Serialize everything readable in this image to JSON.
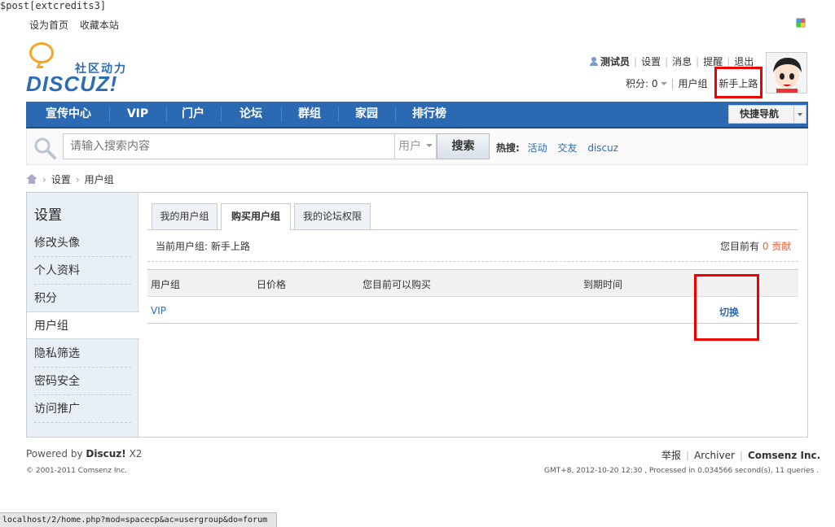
{
  "debug_text": "$post[extcredits3]",
  "top_links": [
    "设为首页",
    "收藏本站"
  ],
  "logo": {
    "text": "DISCUZ!",
    "subtitle": "社区动力"
  },
  "user": {
    "name": "测试员",
    "links": [
      "设置",
      "消息",
      "提醒",
      "退出"
    ],
    "credits_label": "积分: 0",
    "group_label": "用户组",
    "group_value": "新手上路"
  },
  "nav": {
    "items": [
      "宣传中心",
      "VIP",
      "门户",
      "论坛",
      "群组",
      "家园",
      "排行榜"
    ],
    "quick_nav": "快捷导航"
  },
  "search": {
    "placeholder": "请输入搜索内容",
    "type": "用户",
    "button": "搜索",
    "hot_label": "热搜:",
    "hot_links": [
      "活动",
      "交友",
      "discuz"
    ]
  },
  "breadcrumb": [
    "设置",
    "用户组"
  ],
  "sidebar": {
    "title": "设置",
    "items": [
      "修改头像",
      "个人资料",
      "积分",
      "用户组",
      "隐私筛选",
      "密码安全",
      "访问推广"
    ],
    "active": "用户组"
  },
  "tabs": [
    "我的用户组",
    "购买用户组",
    "我的论坛权限"
  ],
  "active_tab": "购买用户组",
  "current_group": "当前用户组: 新手上路",
  "balance": {
    "label": "您目前有",
    "value": "0 贡献"
  },
  "table": {
    "headers": [
      "用户组",
      "日价格",
      "您目前可以购买",
      "到期时间"
    ],
    "rows": [
      {
        "group": "VIP",
        "action": "切换"
      }
    ]
  },
  "footer": {
    "powered_prefix": "Powered by",
    "powered_brand": "Discuz!",
    "powered_version": "X2",
    "copyright": "© 2001-2011 Comsenz Inc.",
    "links": [
      "举报",
      "Archiver"
    ],
    "company": "Comsenz Inc.",
    "stats": "GMT+8, 2012-10-20 12:30 , Processed in 0.034566 second(s), 11 queries ."
  },
  "status_url": "localhost/2/home.php?mod=spacecp&ac=usergroup&do=forum",
  "colors": {
    "nav_bg": "#2b6ab3",
    "link": "#2b6cb3",
    "highlight_box": "#e00000",
    "credit_value": "#e6683e"
  }
}
